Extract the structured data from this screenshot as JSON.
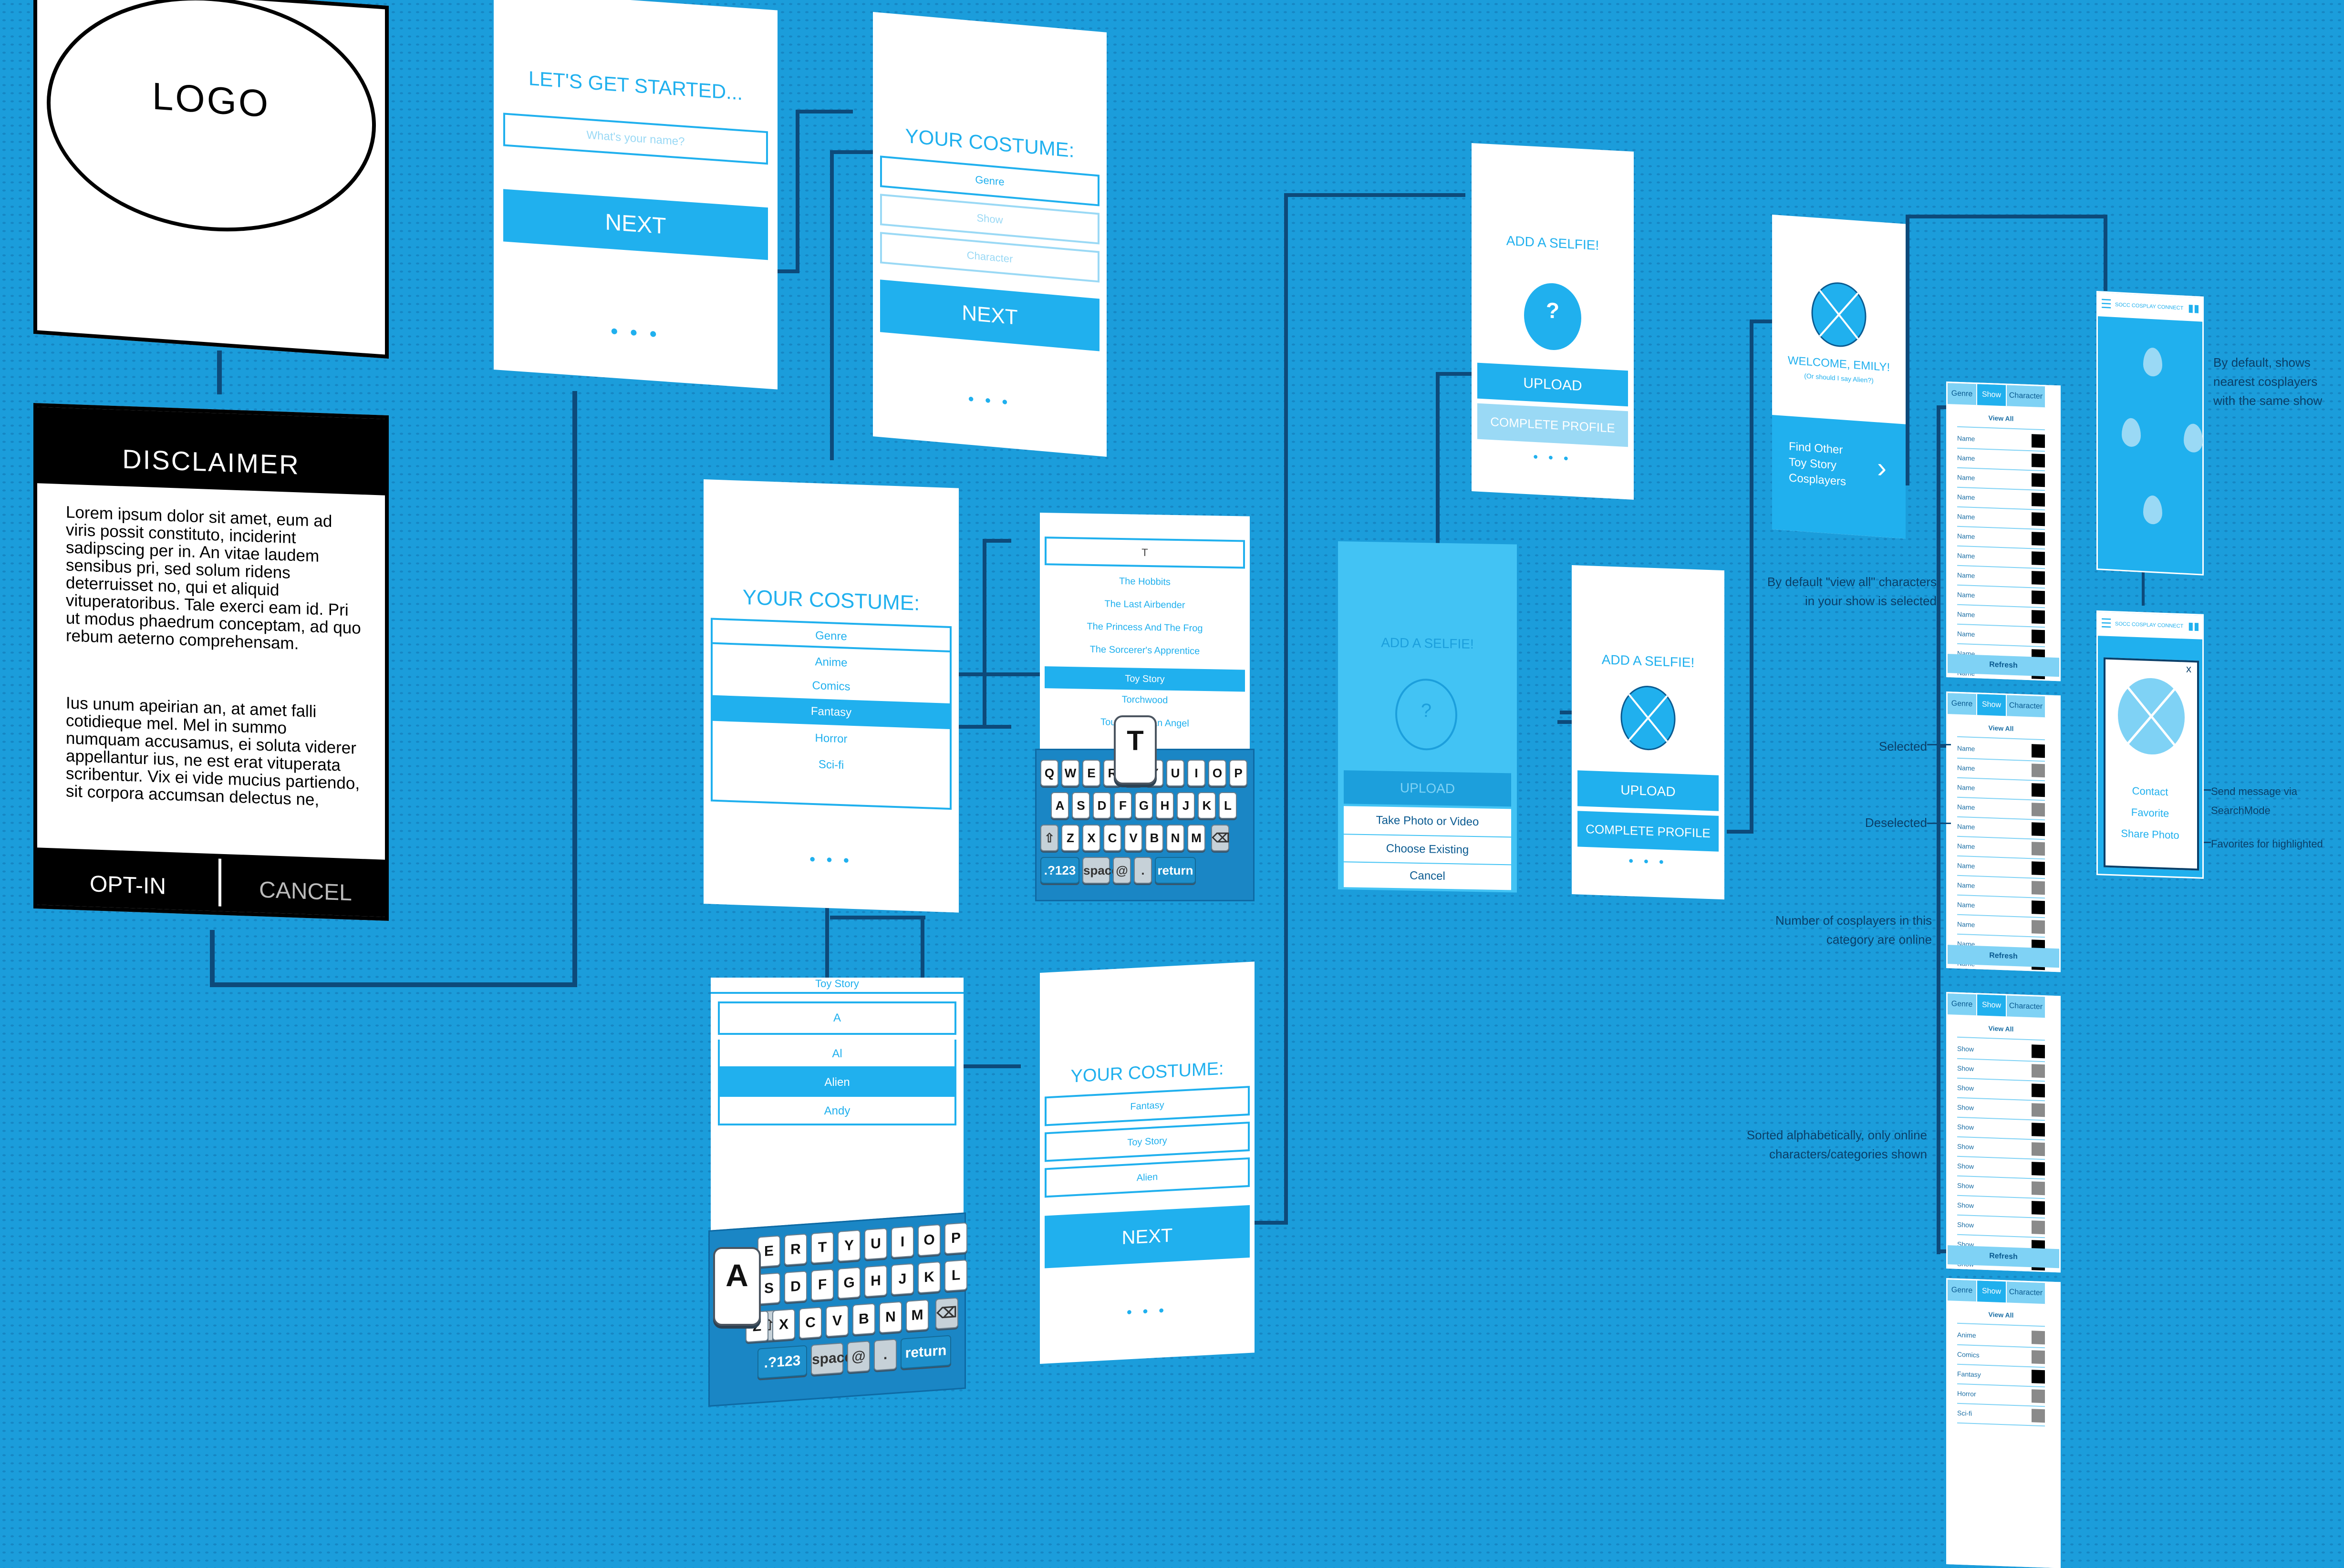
{
  "logo_screen": {
    "logo_text": "LOGO"
  },
  "disclaimer_screen": {
    "title": "DISCLAIMER",
    "paragraph1": "Lorem ipsum dolor sit amet, eum ad viris possit constituto, inciderint sadipscing per in. An vitae laudem sensibus pri, sed solum ridens deterruisset no, qui et aliquid vituperatoribus. Tale exerci eam id. Pri ut modus phaedrum conceptam, ad quo rebum aeterno comprehensam.",
    "paragraph2": "Ius unum apeirian an, at amet falli cotidieque mel. Mel in summo numquam accusamus, ei soluta viderer appellantur ius, ne est erat vituperata scribentur. Vix ei vide mucius partiendo, sit corpora accumsan delectus ne,",
    "opt_in": "OPT-IN",
    "cancel": "CANCEL"
  },
  "get_started_screen": {
    "title": "LET'S GET STARTED...",
    "name_placeholder": "What's your name?",
    "next": "NEXT"
  },
  "costume_screen_1": {
    "title": "YOUR COSTUME:",
    "fields": [
      "Genre",
      "Show",
      "Character"
    ],
    "next": "NEXT"
  },
  "costume_genre_screen": {
    "title": "YOUR COSTUME:",
    "options": [
      "Genre",
      "Anime",
      "Comics",
      "Fantasy",
      "Horror",
      "Sci-fi"
    ],
    "selected": "Fantasy"
  },
  "show_search_screen": {
    "input_value": "T",
    "options": [
      "The Hobbits",
      "The Last Airbender",
      "The Princess And The Frog",
      "The Sorcerer's Apprentice",
      "Toy Story",
      "Torchwood",
      "Touched by an Angel"
    ],
    "selected": "Toy Story"
  },
  "keyboard_t": {
    "row1": [
      "Q",
      "W",
      "E",
      "R",
      "T",
      "Y",
      "U",
      "I",
      "O",
      "P"
    ],
    "row2": [
      "A",
      "S",
      "D",
      "F",
      "G",
      "H",
      "J",
      "K",
      "L"
    ],
    "row3": [
      "Z",
      "X",
      "C",
      "V",
      "B",
      "N",
      "M"
    ],
    "numbers": ".?123",
    "space": "space",
    "at": "@",
    "dot": ".",
    "return": "return",
    "pressed": "T"
  },
  "character_search_screen": {
    "header_value": "Toy Story",
    "input_value": "A",
    "options": [
      "Al",
      "Alien",
      "Andy"
    ],
    "selected": "Alien"
  },
  "keyboard_a": {
    "row1": [
      "E",
      "R",
      "T",
      "Y",
      "U",
      "I",
      "O",
      "P"
    ],
    "row2": [
      "S",
      "D",
      "F",
      "G",
      "H",
      "J",
      "K",
      "L"
    ],
    "row3": [
      "Z",
      "X",
      "C",
      "V",
      "B",
      "N",
      "M"
    ],
    "numbers": ".?123",
    "space": "space",
    "at": "@",
    "dot": ".",
    "return": "return",
    "pressed": "A"
  },
  "costume_summary_screen": {
    "title": "YOUR COSTUME:",
    "fields": [
      "Fantasy",
      "Toy Story",
      "Alien"
    ],
    "next": "NEXT"
  },
  "selfie_screen": {
    "title": "ADD A SELFIE!",
    "avatar_glyph": "?",
    "upload": "UPLOAD",
    "complete": "COMPLETE PROFILE"
  },
  "selfie_actions_screen": {
    "title": "ADD A SELFIE!",
    "avatar_glyph": "?",
    "upload": "UPLOAD",
    "take_photo": "Take Photo or Video",
    "choose_existing": "Choose Existing",
    "cancel": "Cancel"
  },
  "selfie_done_screen": {
    "title": "ADD A SELFIE!",
    "upload": "UPLOAD",
    "complete": "COMPLETE PROFILE"
  },
  "welcome_screen": {
    "title": "WELCOME, EMILY!",
    "subtitle": "(Or should I say Alien?)",
    "find_line1": "Find Other",
    "find_line2": "Toy Story",
    "find_line3": "Cosplayers"
  },
  "list_screens": {
    "tabs": [
      "Genre",
      "Show",
      "Character"
    ],
    "view_all": "View All",
    "refresh": "Refresh",
    "row_label_name": "Name",
    "row_label_show": "Show",
    "genre_rows": [
      "Anime",
      "Comics",
      "Fantasy",
      "Horror",
      "Sci-fi"
    ]
  },
  "annotations": {
    "default_view": "By default \"view all\" characters in your show is selected",
    "selected": "Selected",
    "deselected": "Deselected",
    "cosplayer_count": "Number of cosplayers in this category are online",
    "sorted": "Sorted alphabetically, only online characters/categories shown",
    "map_default": "By default, shows nearest cosplayers with the same show",
    "send_message": "Send message via SearchMode",
    "favorites": "Favorites for highlighted"
  },
  "map_screen": {
    "header_title": "SOCC COSPLAY CONNECT"
  },
  "profile_popup": {
    "header_title": "SOCC COSPLAY CONNECT",
    "close": "x",
    "contact": "Contact",
    "favorite": "Favorite",
    "share": "Share Photo"
  },
  "colors": {
    "accent": "#20b0ee",
    "background": "#1b9ddb",
    "wire": "#0d4a7a"
  }
}
